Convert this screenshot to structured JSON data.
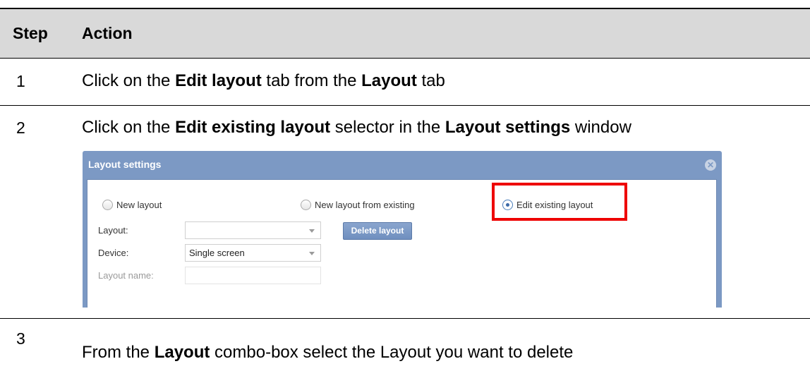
{
  "header": {
    "step": "Step",
    "action": "Action"
  },
  "steps": [
    {
      "number": "1",
      "parts": [
        "Click on the ",
        "Edit layout",
        " tab from the ",
        "Layout",
        " tab"
      ]
    },
    {
      "number": "2",
      "parts": [
        "Click on the ",
        "Edit existing layout",
        " selector in the ",
        "Layout settings",
        " window"
      ]
    },
    {
      "number": "3",
      "parts": [
        "From the ",
        "Layout",
        " combo-box select the Layout you want to delete"
      ]
    }
  ],
  "dialog": {
    "title": "Layout settings",
    "close_icon": "close-circle-icon",
    "radios": [
      {
        "label": "New layout",
        "checked": false
      },
      {
        "label": "New layout from existing",
        "checked": false
      },
      {
        "label": "Edit existing layout",
        "checked": true
      }
    ],
    "layout_label": "Layout:",
    "layout_value": "",
    "delete_button": "Delete layout",
    "device_label": "Device:",
    "device_value": "Single screen",
    "layout_name_label": "Layout name:",
    "layout_name_value": "",
    "highlight_color": "#ee0000",
    "titlebar_color": "#7c99c4"
  }
}
